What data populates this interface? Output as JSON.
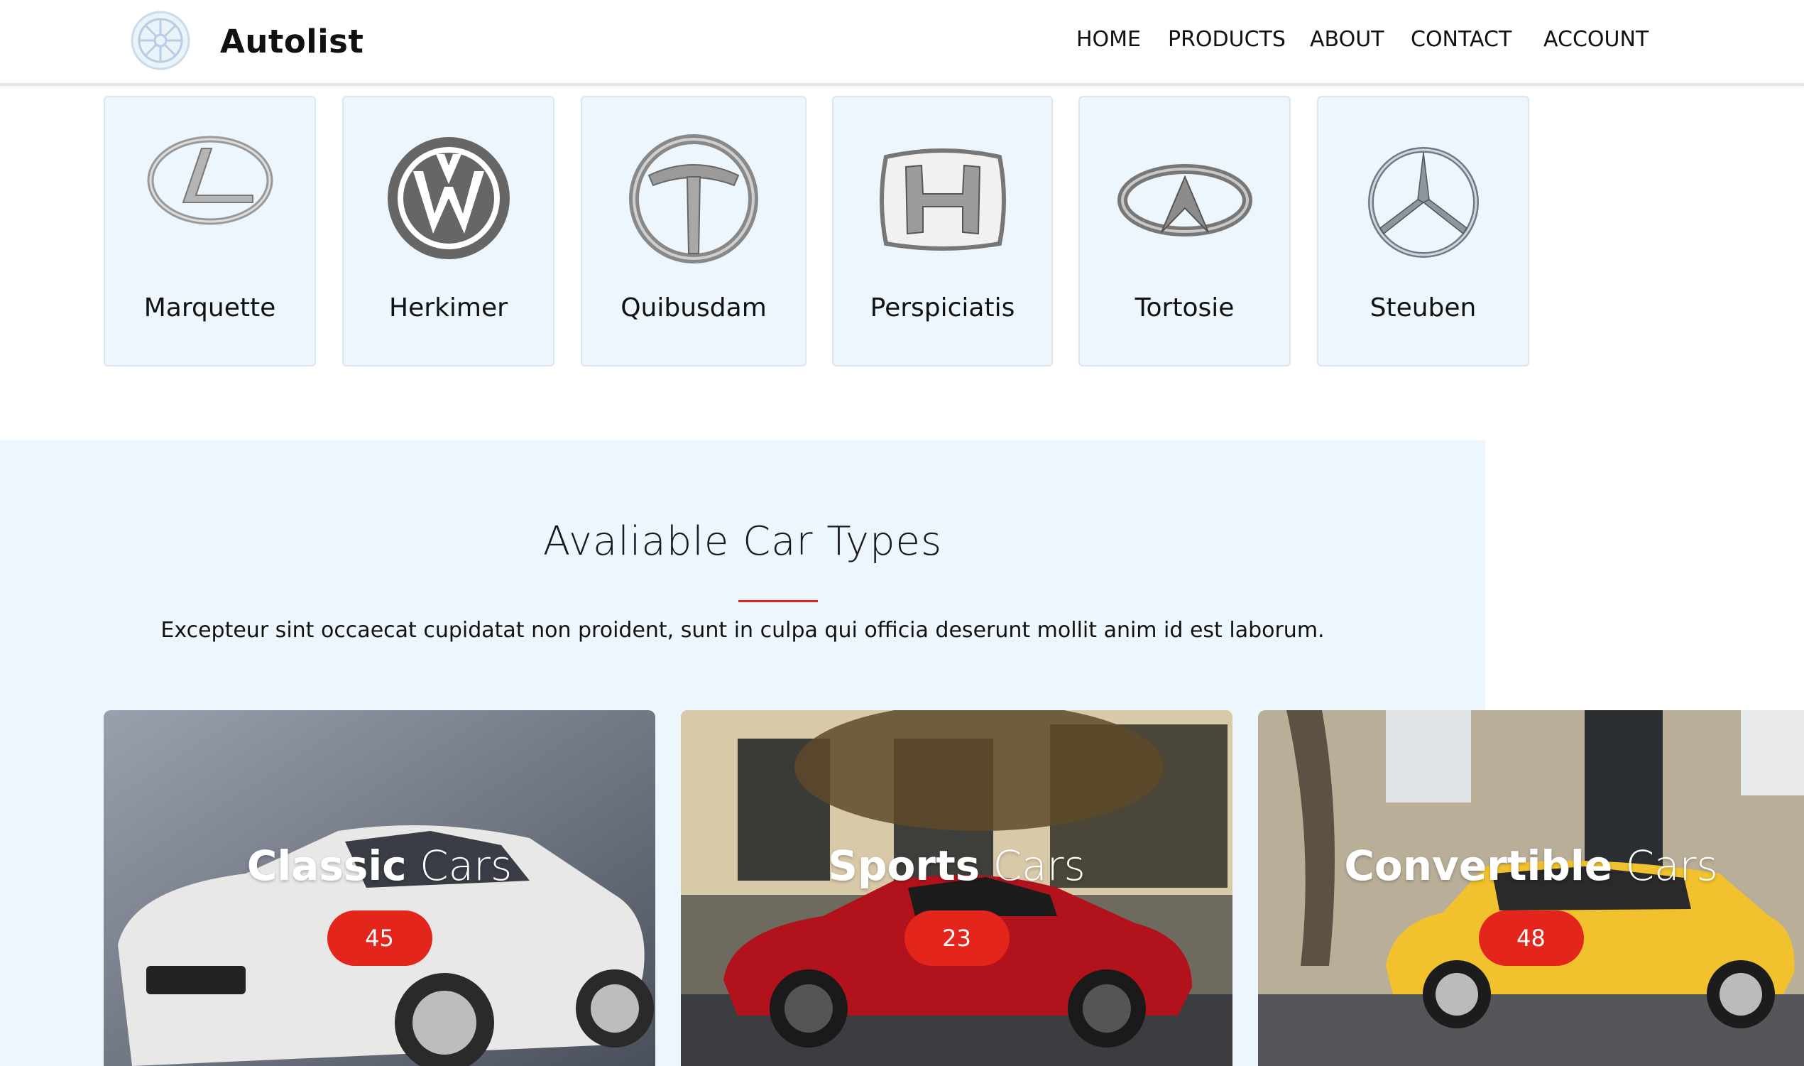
{
  "header": {
    "brand": "Autolist",
    "nav": [
      "HOME",
      "PRODUCTS",
      "ABOUT",
      "CONTACT",
      "ACCOUNT"
    ]
  },
  "brands": [
    {
      "name": "Marquette",
      "icon": "lexus-logo-icon"
    },
    {
      "name": "Herkimer",
      "icon": "volkswagen-logo-icon"
    },
    {
      "name": "Quibusdam",
      "icon": "tata-logo-icon"
    },
    {
      "name": "Perspiciatis",
      "icon": "honda-logo-icon"
    },
    {
      "name": "Tortosie",
      "icon": "infiniti-logo-icon"
    },
    {
      "name": "Steuben",
      "icon": "mercedes-logo-icon"
    }
  ],
  "car_types": {
    "title": "Avaliable Car Types",
    "description": "Excepteur sint occaecat cupidatat non proident, sunt in culpa qui officia deserunt mollit anim id est laborum.",
    "cards": [
      {
        "name": "Classic",
        "suffix": "Cars",
        "count": "45"
      },
      {
        "name": "Sports",
        "suffix": "Cars",
        "count": "23"
      },
      {
        "name": "Convertible",
        "suffix": "Cars",
        "count": "48"
      }
    ]
  },
  "colors": {
    "accent": "#e3251c",
    "section_bg": "#eef6fd"
  }
}
